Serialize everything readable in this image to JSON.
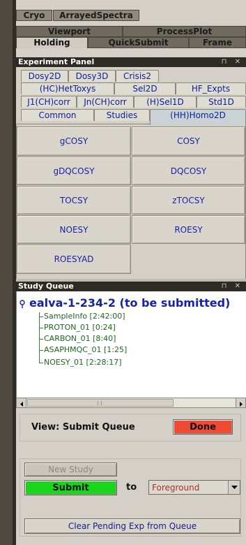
{
  "top_tabs": {
    "row1": [
      "Cryo",
      "ArrayedSpectra"
    ],
    "row2": [
      "Viewport",
      "ProcessPlot"
    ],
    "row3": [
      "Holding",
      "QuickSubmit",
      "Frame"
    ]
  },
  "experiment_panel": {
    "title": "Experiment Panel",
    "controls": "⊓ ✕",
    "tab_rows": [
      [
        "Dosy2D",
        "Dosy3D",
        "Crisis2"
      ],
      [
        "(HC)HetToxys",
        "Sel2D",
        "HF_Expts"
      ],
      [
        "J1(CH)corr",
        "Jn(CH)corr",
        "(H)Sel1D",
        "Std1D"
      ],
      [
        "Common",
        "Studies",
        "(HH)Homo2D"
      ]
    ],
    "active_tab": "(HH)Homo2D",
    "buttons": [
      "gCOSY",
      "COSY",
      "gDQCOSY",
      "DQCOSY",
      "TOCSY",
      "zTOCSY",
      "NOESY",
      "ROESY",
      "ROESYAD"
    ]
  },
  "study_queue": {
    "title": "Study Queue",
    "controls": "⊓ ✕",
    "root_label": "ealva-1-234-2 (to be submitted)",
    "items": [
      "SampleInfo [2:42:00]",
      "PROTON_01 [0:24]",
      "CARBON_01 [8:40]",
      "ASAPHMQC_01 [1:25]",
      "NOESY_01 [2:28:17]"
    ]
  },
  "view_bar": {
    "label": "View: Submit Queue",
    "done_label": "Done"
  },
  "submit_area": {
    "new_study_label": "New Study",
    "submit_label": "Submit",
    "to_label": "to",
    "destination_value": "Foreground",
    "clear_label": "Clear Pending Exp from Queue"
  },
  "colors": {
    "done_button": "#ef4a35",
    "submit_button": "#19d61d",
    "title_text": "#1622a8",
    "queue_item_text": "#1f6a1f"
  }
}
